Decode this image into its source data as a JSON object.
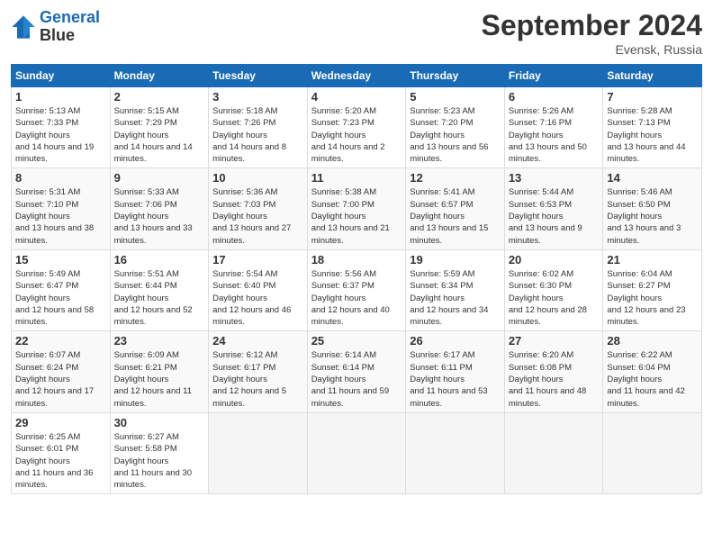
{
  "header": {
    "logo_line1": "General",
    "logo_line2": "Blue",
    "month": "September 2024",
    "location": "Evensk, Russia"
  },
  "weekdays": [
    "Sunday",
    "Monday",
    "Tuesday",
    "Wednesday",
    "Thursday",
    "Friday",
    "Saturday"
  ],
  "weeks": [
    [
      {
        "day": "1",
        "sunrise": "5:13 AM",
        "sunset": "7:33 PM",
        "daylight": "14 hours and 19 minutes."
      },
      {
        "day": "2",
        "sunrise": "5:15 AM",
        "sunset": "7:29 PM",
        "daylight": "14 hours and 14 minutes."
      },
      {
        "day": "3",
        "sunrise": "5:18 AM",
        "sunset": "7:26 PM",
        "daylight": "14 hours and 8 minutes."
      },
      {
        "day": "4",
        "sunrise": "5:20 AM",
        "sunset": "7:23 PM",
        "daylight": "14 hours and 2 minutes."
      },
      {
        "day": "5",
        "sunrise": "5:23 AM",
        "sunset": "7:20 PM",
        "daylight": "13 hours and 56 minutes."
      },
      {
        "day": "6",
        "sunrise": "5:26 AM",
        "sunset": "7:16 PM",
        "daylight": "13 hours and 50 minutes."
      },
      {
        "day": "7",
        "sunrise": "5:28 AM",
        "sunset": "7:13 PM",
        "daylight": "13 hours and 44 minutes."
      }
    ],
    [
      {
        "day": "8",
        "sunrise": "5:31 AM",
        "sunset": "7:10 PM",
        "daylight": "13 hours and 38 minutes."
      },
      {
        "day": "9",
        "sunrise": "5:33 AM",
        "sunset": "7:06 PM",
        "daylight": "13 hours and 33 minutes."
      },
      {
        "day": "10",
        "sunrise": "5:36 AM",
        "sunset": "7:03 PM",
        "daylight": "13 hours and 27 minutes."
      },
      {
        "day": "11",
        "sunrise": "5:38 AM",
        "sunset": "7:00 PM",
        "daylight": "13 hours and 21 minutes."
      },
      {
        "day": "12",
        "sunrise": "5:41 AM",
        "sunset": "6:57 PM",
        "daylight": "13 hours and 15 minutes."
      },
      {
        "day": "13",
        "sunrise": "5:44 AM",
        "sunset": "6:53 PM",
        "daylight": "13 hours and 9 minutes."
      },
      {
        "day": "14",
        "sunrise": "5:46 AM",
        "sunset": "6:50 PM",
        "daylight": "13 hours and 3 minutes."
      }
    ],
    [
      {
        "day": "15",
        "sunrise": "5:49 AM",
        "sunset": "6:47 PM",
        "daylight": "12 hours and 58 minutes."
      },
      {
        "day": "16",
        "sunrise": "5:51 AM",
        "sunset": "6:44 PM",
        "daylight": "12 hours and 52 minutes."
      },
      {
        "day": "17",
        "sunrise": "5:54 AM",
        "sunset": "6:40 PM",
        "daylight": "12 hours and 46 minutes."
      },
      {
        "day": "18",
        "sunrise": "5:56 AM",
        "sunset": "6:37 PM",
        "daylight": "12 hours and 40 minutes."
      },
      {
        "day": "19",
        "sunrise": "5:59 AM",
        "sunset": "6:34 PM",
        "daylight": "12 hours and 34 minutes."
      },
      {
        "day": "20",
        "sunrise": "6:02 AM",
        "sunset": "6:30 PM",
        "daylight": "12 hours and 28 minutes."
      },
      {
        "day": "21",
        "sunrise": "6:04 AM",
        "sunset": "6:27 PM",
        "daylight": "12 hours and 23 minutes."
      }
    ],
    [
      {
        "day": "22",
        "sunrise": "6:07 AM",
        "sunset": "6:24 PM",
        "daylight": "12 hours and 17 minutes."
      },
      {
        "day": "23",
        "sunrise": "6:09 AM",
        "sunset": "6:21 PM",
        "daylight": "12 hours and 11 minutes."
      },
      {
        "day": "24",
        "sunrise": "6:12 AM",
        "sunset": "6:17 PM",
        "daylight": "12 hours and 5 minutes."
      },
      {
        "day": "25",
        "sunrise": "6:14 AM",
        "sunset": "6:14 PM",
        "daylight": "11 hours and 59 minutes."
      },
      {
        "day": "26",
        "sunrise": "6:17 AM",
        "sunset": "6:11 PM",
        "daylight": "11 hours and 53 minutes."
      },
      {
        "day": "27",
        "sunrise": "6:20 AM",
        "sunset": "6:08 PM",
        "daylight": "11 hours and 48 minutes."
      },
      {
        "day": "28",
        "sunrise": "6:22 AM",
        "sunset": "6:04 PM",
        "daylight": "11 hours and 42 minutes."
      }
    ],
    [
      {
        "day": "29",
        "sunrise": "6:25 AM",
        "sunset": "6:01 PM",
        "daylight": "11 hours and 36 minutes."
      },
      {
        "day": "30",
        "sunrise": "6:27 AM",
        "sunset": "5:58 PM",
        "daylight": "11 hours and 30 minutes."
      },
      null,
      null,
      null,
      null,
      null
    ]
  ]
}
